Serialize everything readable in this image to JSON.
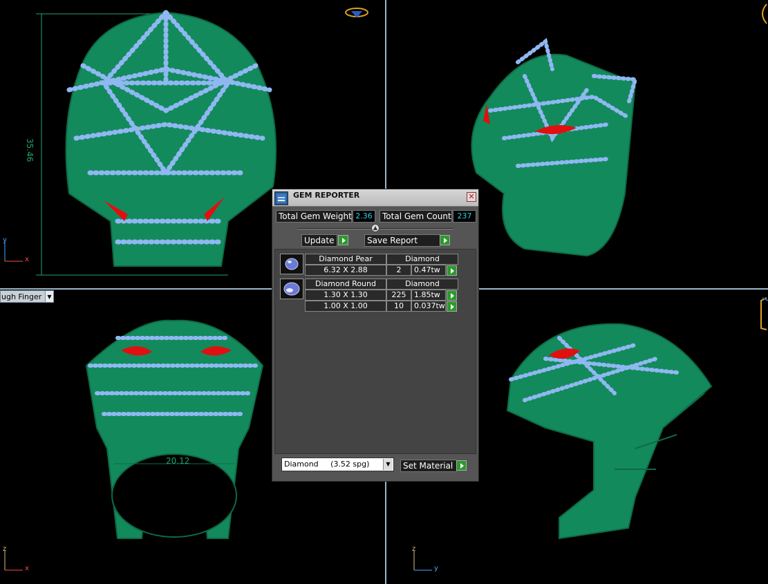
{
  "dimensions": {
    "height": "35.46",
    "width": "20.12"
  },
  "viewport_name": "ugh Finger",
  "axes": {
    "x": "x",
    "y": "y",
    "z": "z"
  },
  "colors": {
    "metal": "#1a9b6a",
    "gem": "#8fb8f2",
    "ruby": "#e01010",
    "panel": "#555555"
  },
  "gem_reporter": {
    "title": "GEM REPORTER",
    "close_icon": "close-icon",
    "total_weight_label": "Total Gem Weight",
    "total_weight_value": "2.36",
    "total_count_label": "Total Gem Count",
    "total_count_value": "237",
    "update_label": "Update",
    "save_report_label": "Save Report",
    "groups": [
      {
        "shape": "Diamond Pear",
        "material": "Diamond",
        "rows": [
          {
            "size": "6.32 X 2.88",
            "count": "2",
            "weight": "0.47tw"
          }
        ]
      },
      {
        "shape": "Diamond Round",
        "material": "Diamond",
        "rows": [
          {
            "size": "1.30 X 1.30",
            "count": "225",
            "weight": "1.85tw"
          },
          {
            "size": "1.00 X 1.00",
            "count": "10",
            "weight": "0.037tw"
          }
        ]
      }
    ],
    "material_select": "Diamond     (3.52 spg)",
    "set_material_label": "Set Material"
  }
}
